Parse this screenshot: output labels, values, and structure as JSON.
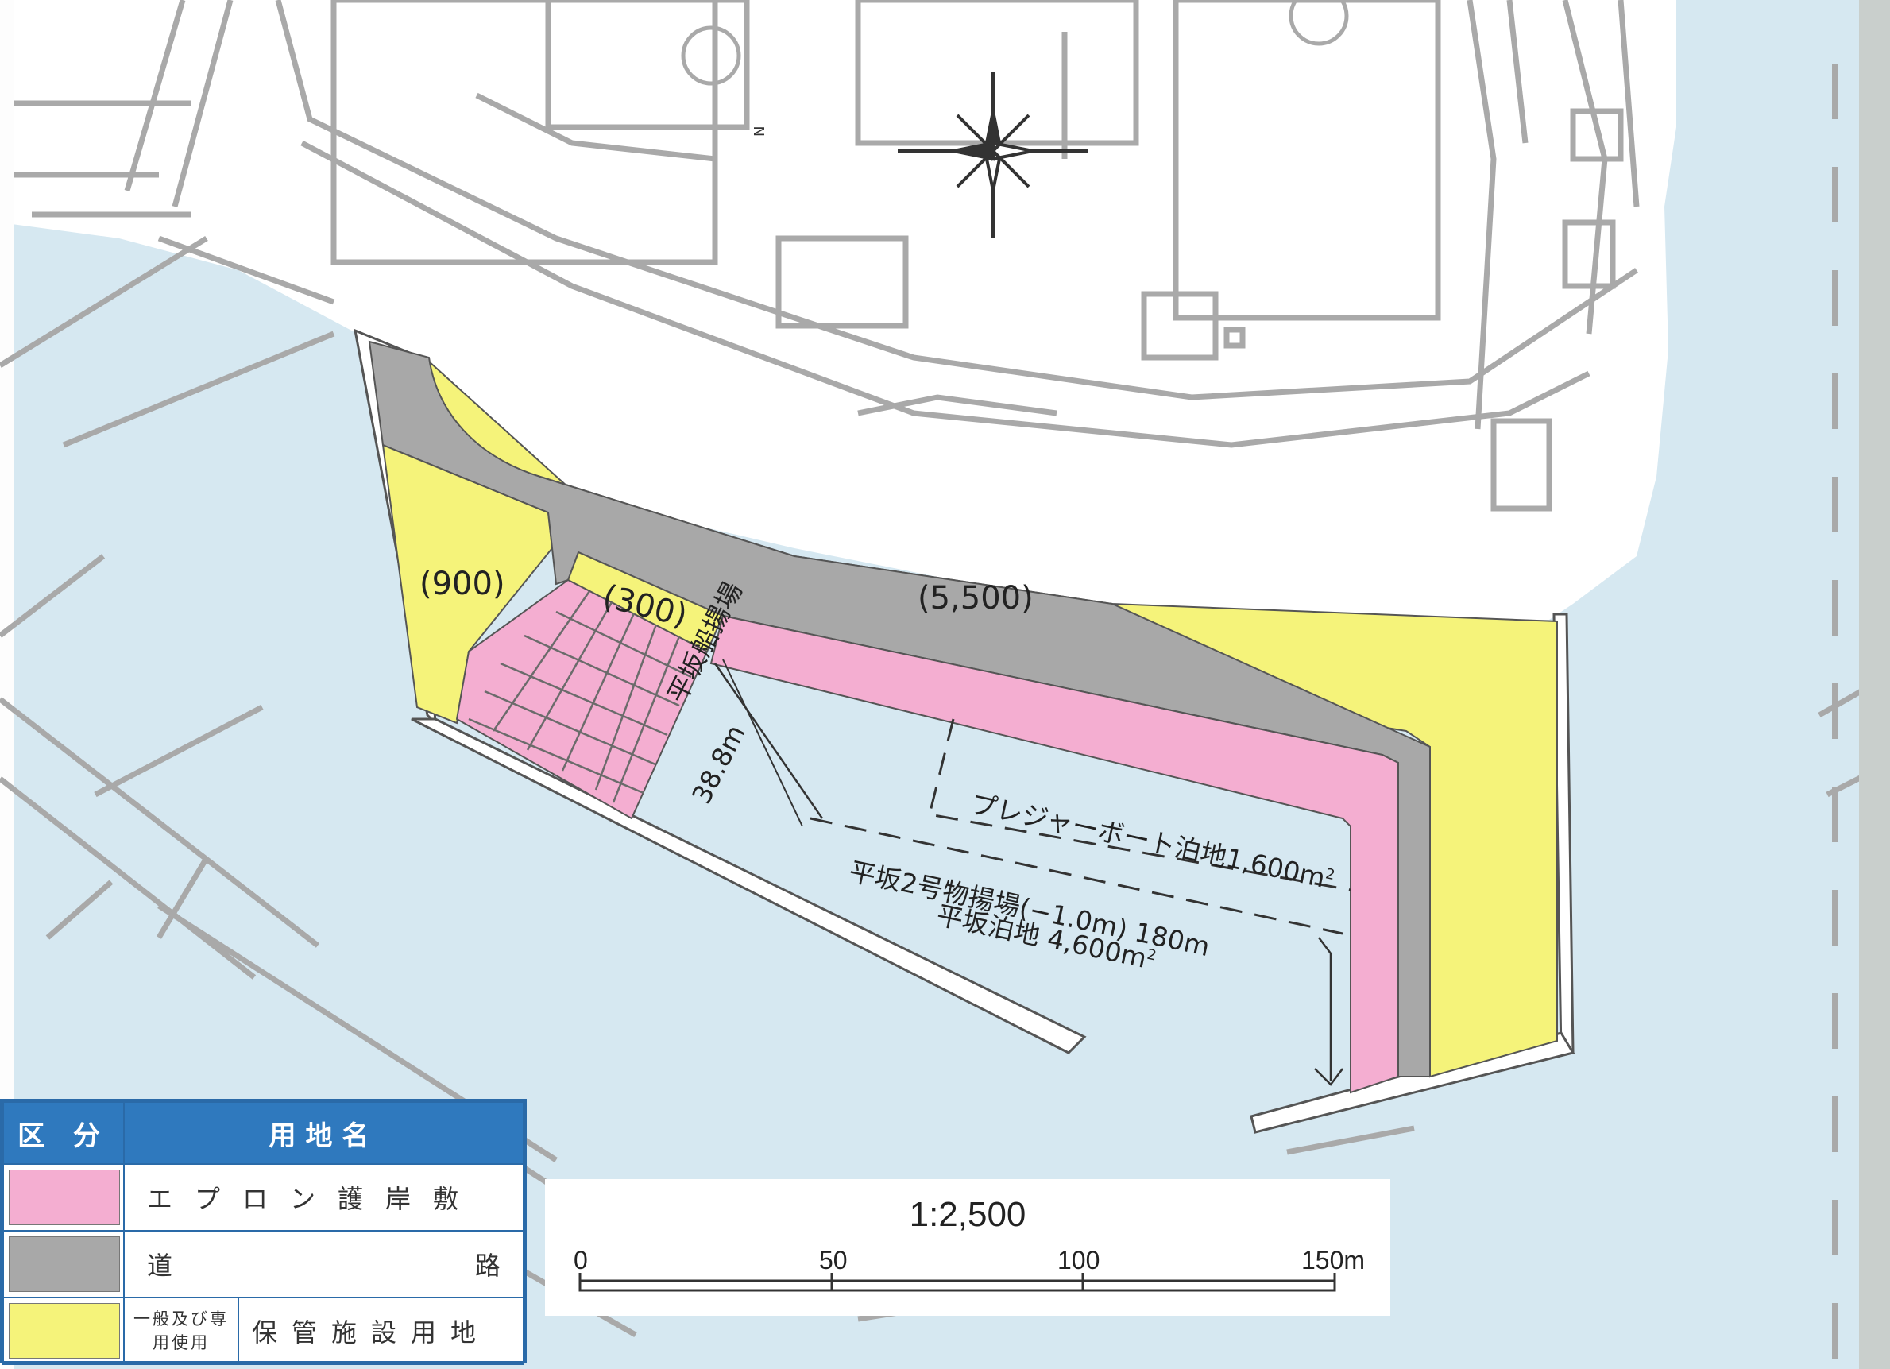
{
  "map": {
    "area_labels": [
      "(900)",
      "(300)",
      "(5,500)"
    ],
    "facility_labels": {
      "slipway_name": "平坂船揚場",
      "slipway_length": "38.8m",
      "pleasure_boat": "プレジャーボート泊地1,600m",
      "unloading_quay": "平坂2号物揚場(−1.0m) 180m",
      "anchorage": "平坂泊地 4,600m",
      "sq_unit": "2"
    },
    "north_arrow_letter": "N"
  },
  "legend": {
    "header_category": "区 分",
    "header_name": "用地名",
    "rows": [
      {
        "color": "#f4aed1",
        "name": "エプロン護岸敷"
      },
      {
        "color": "#a8a8a8",
        "name_left": "道",
        "name_right": "路"
      },
      {
        "color": "#f5f37a",
        "sub_label": "一般及び専用使用",
        "name": "保管施設用地"
      }
    ]
  },
  "scale": {
    "title": "1:2,500",
    "ticks": [
      "0",
      "50",
      "100",
      "150m"
    ]
  },
  "colors": {
    "water": "#d6e8f1",
    "land": "#ffffff",
    "apron": "#f4aed1",
    "road": "#a8a8a8",
    "storage": "#f5f37a",
    "linework": "#a9a9a9"
  }
}
